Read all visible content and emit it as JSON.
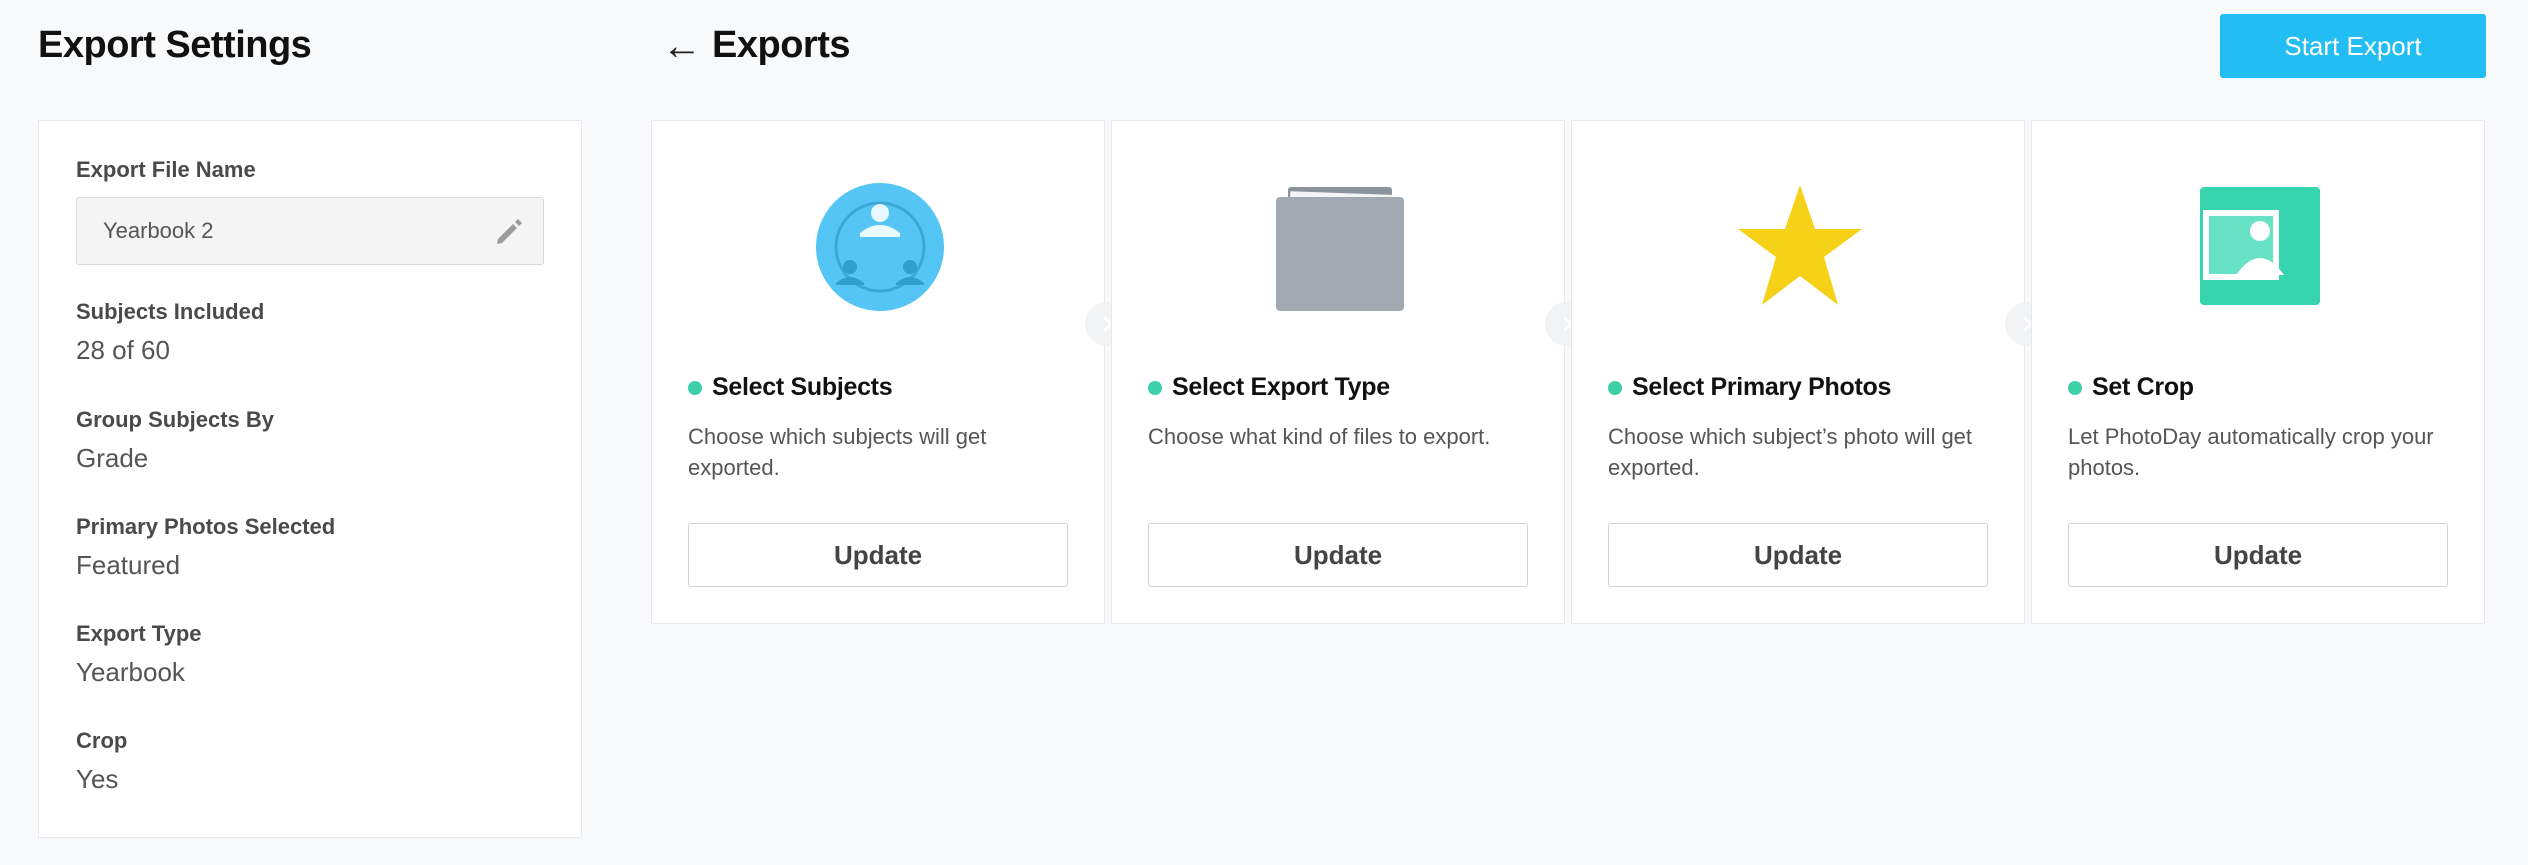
{
  "settings": {
    "title": "Export Settings",
    "file_name_label": "Export File Name",
    "file_name_value": "Yearbook 2",
    "fields": [
      {
        "label": "Subjects Included",
        "value": "28 of 60"
      },
      {
        "label": "Group Subjects By",
        "value": "Grade"
      },
      {
        "label": "Primary Photos Selected",
        "value": "Featured"
      },
      {
        "label": "Export Type",
        "value": "Yearbook"
      },
      {
        "label": "Crop",
        "value": "Yes"
      }
    ]
  },
  "header": {
    "back_icon": "←",
    "title": "Exports",
    "start_export_label": "Start Export"
  },
  "steps": [
    {
      "icon": "subjects-icon",
      "title": "Select Subjects",
      "description": "Choose which subjects will get exported.",
      "button": "Update"
    },
    {
      "icon": "folder-icon",
      "title": "Select Export Type",
      "description": "Choose what kind of files to export.",
      "button": "Update"
    },
    {
      "icon": "star-icon",
      "title": "Select Primary Photos",
      "description": "Choose which subject’s photo will get exported.",
      "button": "Update"
    },
    {
      "icon": "crop-icon",
      "title": "Set Crop",
      "description": "Let PhotoDay automatically crop your photos.",
      "button": "Update"
    }
  ],
  "colors": {
    "accent": "#22bdf2",
    "status_dot": "#3ccfa8",
    "subjects_icon": "#55c5f5",
    "folder_icon": "#a3a9b1",
    "star_icon": "#f5d117",
    "crop_icon": "#37d4b0"
  }
}
